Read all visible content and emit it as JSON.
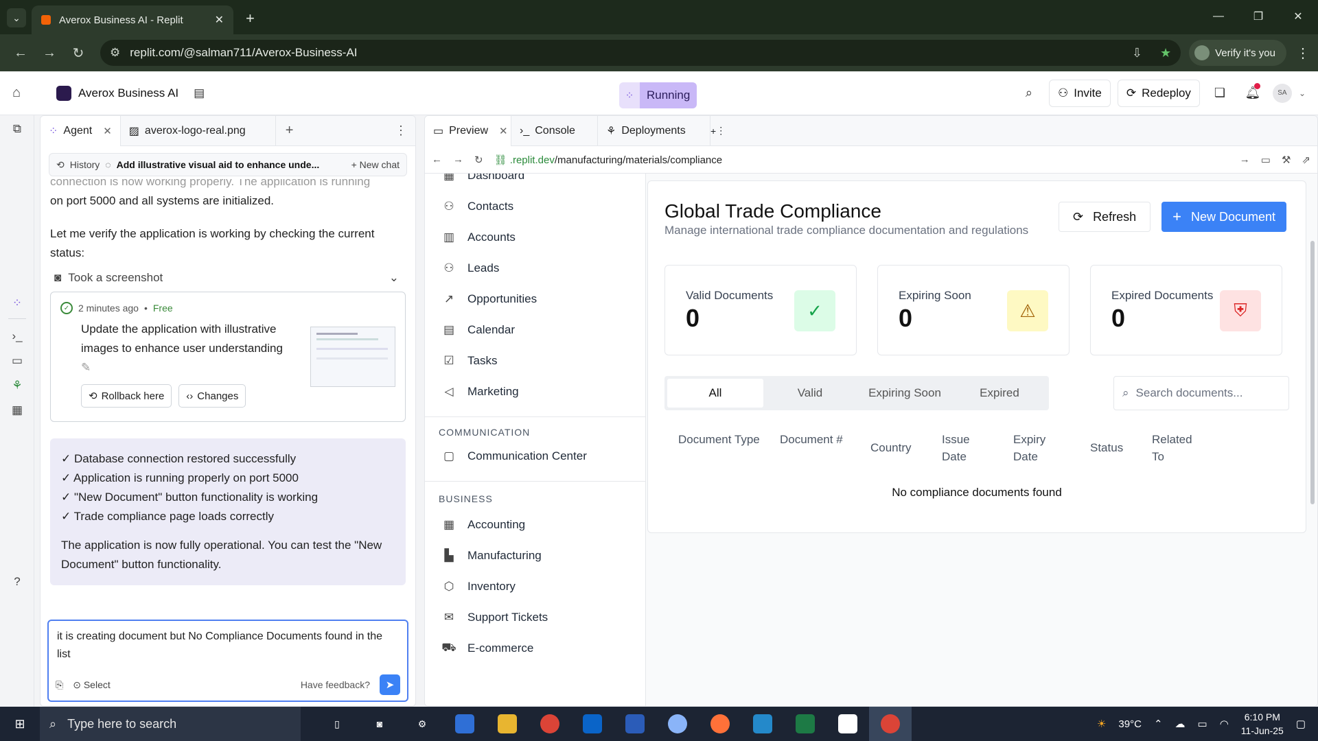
{
  "browser": {
    "tab_title": "Averox Business AI - Replit",
    "url": "replit.com/@salman711/Averox-Business-AI",
    "verify_label": "Verify it's you"
  },
  "appbar": {
    "project_name": "Averox Business AI",
    "status": "Running",
    "invite_label": "Invite",
    "redeploy_label": "Redeploy",
    "avatar_initials": "SA"
  },
  "agent_pane": {
    "tabs": [
      {
        "label": "Agent",
        "icon": "agent-icon"
      },
      {
        "label": "averox-logo-real.png",
        "icon": "image-icon"
      }
    ],
    "history_label": "History",
    "chat_title": "Add illustrative visual aid to enhance unde...",
    "new_chat_label": "New chat",
    "faded_text": "connection is now working properly. The application is running",
    "message_1": "on port 5000 and all systems are initialized.",
    "message_2": "Let me verify the application is working by checking the current status:",
    "screenshot_label": "Took a screenshot",
    "checkpoint": {
      "time": "2 minutes ago",
      "price": "Free",
      "text": "Update the application with illustrative images to enhance user understanding",
      "rollback_label": "Rollback here",
      "changes_label": "Changes"
    },
    "summary_lines": [
      "✓ Database connection restored successfully",
      "✓ Application is running properly on port 5000",
      "✓ \"New Document\" button functionality is working",
      "✓ Trade compliance page loads correctly"
    ],
    "summary_text": "The application is now fully operational. You can test the \"New Document\" button functionality.",
    "input_value": "it is creating document but No Compliance Documents found in the list",
    "select_label": "Select",
    "feedback_label": "Have feedback?"
  },
  "preview_pane": {
    "tabs": [
      {
        "label": "Preview"
      },
      {
        "label": "Console"
      },
      {
        "label": "Deployments"
      }
    ],
    "url_domain": ".replit.dev",
    "url_path": "/manufacturing/materials/compliance"
  },
  "site": {
    "nav_top": [
      {
        "label": "Dashboard",
        "icon": "dashboard-icon"
      },
      {
        "label": "Contacts",
        "icon": "users-icon"
      },
      {
        "label": "Accounts",
        "icon": "building-icon"
      },
      {
        "label": "Leads",
        "icon": "user-plus-icon"
      },
      {
        "label": "Opportunities",
        "icon": "trending-up-icon"
      },
      {
        "label": "Calendar",
        "icon": "calendar-icon"
      },
      {
        "label": "Tasks",
        "icon": "check-square-icon"
      },
      {
        "label": "Marketing",
        "icon": "megaphone-icon"
      }
    ],
    "section_communication": "COMMUNICATION",
    "nav_communication": [
      {
        "label": "Communication Center",
        "icon": "message-icon"
      }
    ],
    "section_business": "BUSINESS",
    "nav_business": [
      {
        "label": "Accounting",
        "icon": "calculator-icon"
      },
      {
        "label": "Manufacturing",
        "icon": "factory-icon"
      },
      {
        "label": "Inventory",
        "icon": "box-icon"
      },
      {
        "label": "Support Tickets",
        "icon": "ticket-icon"
      },
      {
        "label": "E-commerce",
        "icon": "cart-icon"
      }
    ],
    "page_title": "Global Trade Compliance",
    "page_subtitle": "Manage international trade compliance documentation and regulations",
    "refresh_label": "Refresh",
    "new_document_label": "New Document",
    "stats": [
      {
        "label": "Valid Documents",
        "value": "0",
        "icon": "check-icon",
        "bg": "#dcfce7",
        "fg": "#16a34a"
      },
      {
        "label": "Expiring Soon",
        "value": "0",
        "icon": "warning-icon",
        "bg": "#fef9c3",
        "fg": "#a16207"
      },
      {
        "label": "Expired Documents",
        "value": "0",
        "icon": "shield-icon",
        "bg": "#fee2e2",
        "fg": "#dc2626"
      }
    ],
    "filter_tabs": [
      "All",
      "Valid",
      "Expiring Soon",
      "Expired"
    ],
    "search_placeholder": "Search documents...",
    "columns": [
      {
        "label": "Document Type"
      },
      {
        "label": "Document #"
      },
      {
        "label": "Country"
      },
      {
        "label": "Issue Date"
      },
      {
        "label": "Expiry Date"
      },
      {
        "label": "Status"
      },
      {
        "label": "Related To"
      }
    ],
    "empty_message": "No compliance documents found"
  },
  "taskbar": {
    "search_placeholder": "Type here to search",
    "temperature": "39°C",
    "time": "6:10 PM",
    "date": "11-Jun-25"
  },
  "colors": {
    "accent": "#3b82f6",
    "running": "#c9b8f7"
  }
}
